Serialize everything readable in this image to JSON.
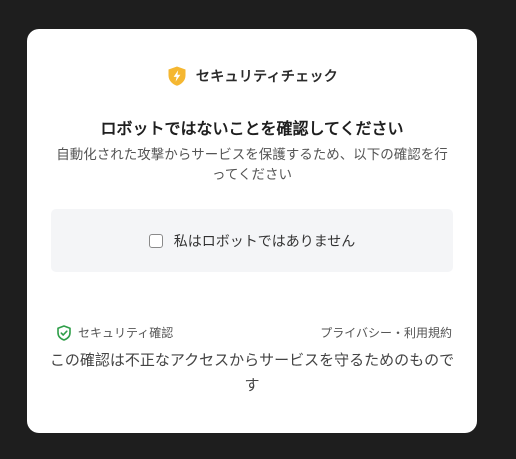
{
  "brand": {
    "name": "セキュリティチェック",
    "icon": "shield-bolt-icon",
    "icon_color": "#f5b731"
  },
  "title": "ロボットではないことを確認してください",
  "subtitle": "自動化された攻撃からサービスを保護するため、以下の確認を行ってください",
  "checkbox": {
    "label": "私はロボットではありません",
    "checked": false
  },
  "footer": {
    "security_label": "セキュリティ確認",
    "security_icon": "shield-check-icon",
    "security_icon_color": "#2e9e48",
    "links": "プライバシー・利用規約"
  },
  "note": "この確認は不正なアクセスからサービスを守るためのものです"
}
